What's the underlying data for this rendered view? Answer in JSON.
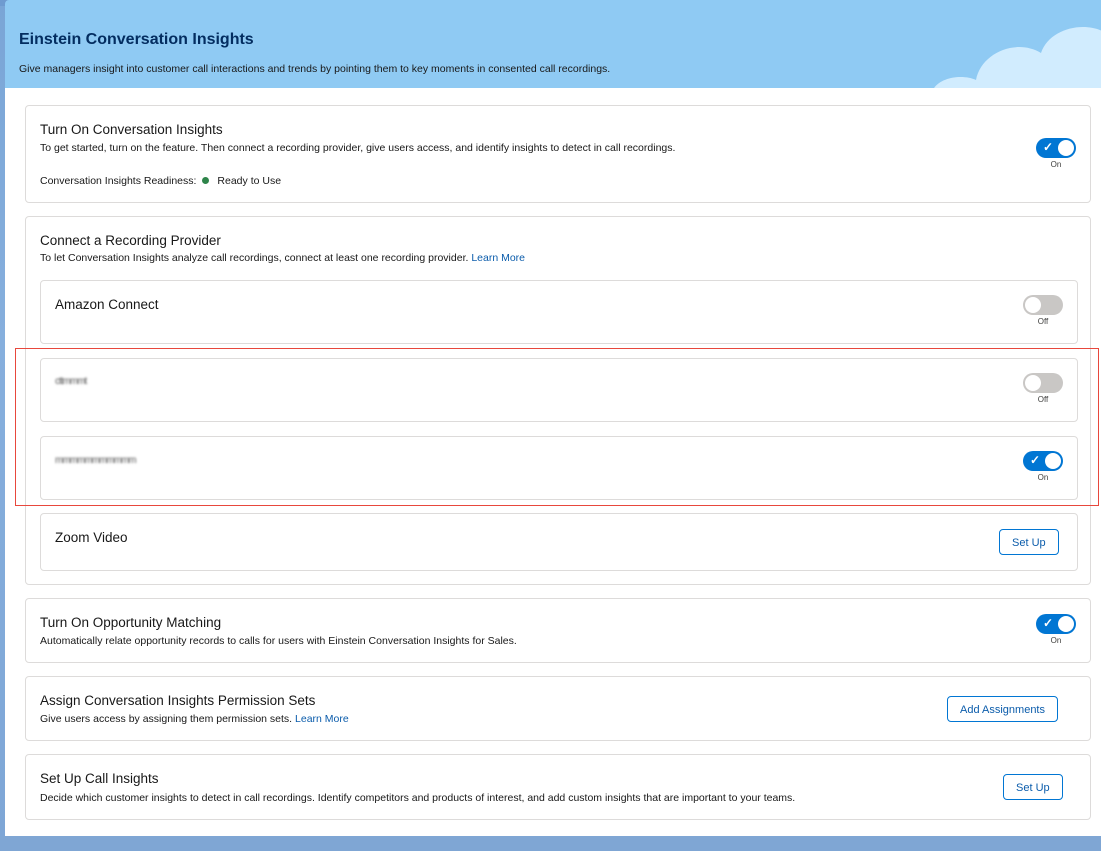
{
  "header": {
    "title": "Einstein Conversation Insights",
    "subtitle": "Give managers insight into customer call interactions and trends by pointing them to key moments in consented call recordings."
  },
  "turn_on_ci": {
    "title": "Turn On Conversation Insights",
    "description": "To get started, turn on the feature. Then connect a recording provider, give users access, and identify insights to detect in call recordings.",
    "readiness_label": "Conversation Insights Readiness:",
    "readiness_status": "Ready to Use",
    "toggle_label": "On"
  },
  "recording_provider": {
    "title": "Connect a Recording Provider",
    "description": "To let Conversation Insights analyze call recordings, connect at least one recording provider.",
    "learn_more": "Learn More",
    "providers": [
      {
        "name": "Amazon Connect",
        "toggle_label": "Off"
      },
      {
        "name": "cttmmmt",
        "toggle_label": "Off"
      },
      {
        "name": "mmmmmmmmmmm",
        "toggle_label": "On"
      },
      {
        "name": "Zoom Video",
        "button_label": "Set Up"
      }
    ]
  },
  "opportunity_matching": {
    "title": "Turn On Opportunity Matching",
    "description": "Automatically relate opportunity records to calls for users with Einstein Conversation Insights for Sales.",
    "toggle_label": "On"
  },
  "permission_sets": {
    "title": "Assign Conversation Insights Permission Sets",
    "description": "Give users access by assigning them permission sets.",
    "learn_more": "Learn More",
    "button_label": "Add Assignments"
  },
  "call_insights": {
    "title": "Set Up Call Insights",
    "description": "Decide which customer insights to detect in call recordings. Identify competitors and products of interest, and add custom insights that are important to your teams.",
    "button_label": "Set Up"
  },
  "colors": {
    "brand_blue": "#0176d3",
    "toggle_off": "#c9c7c5",
    "ready_green": "#2e844a",
    "highlight_red": "#e8473c",
    "header_bg": "#8fcaf3"
  }
}
